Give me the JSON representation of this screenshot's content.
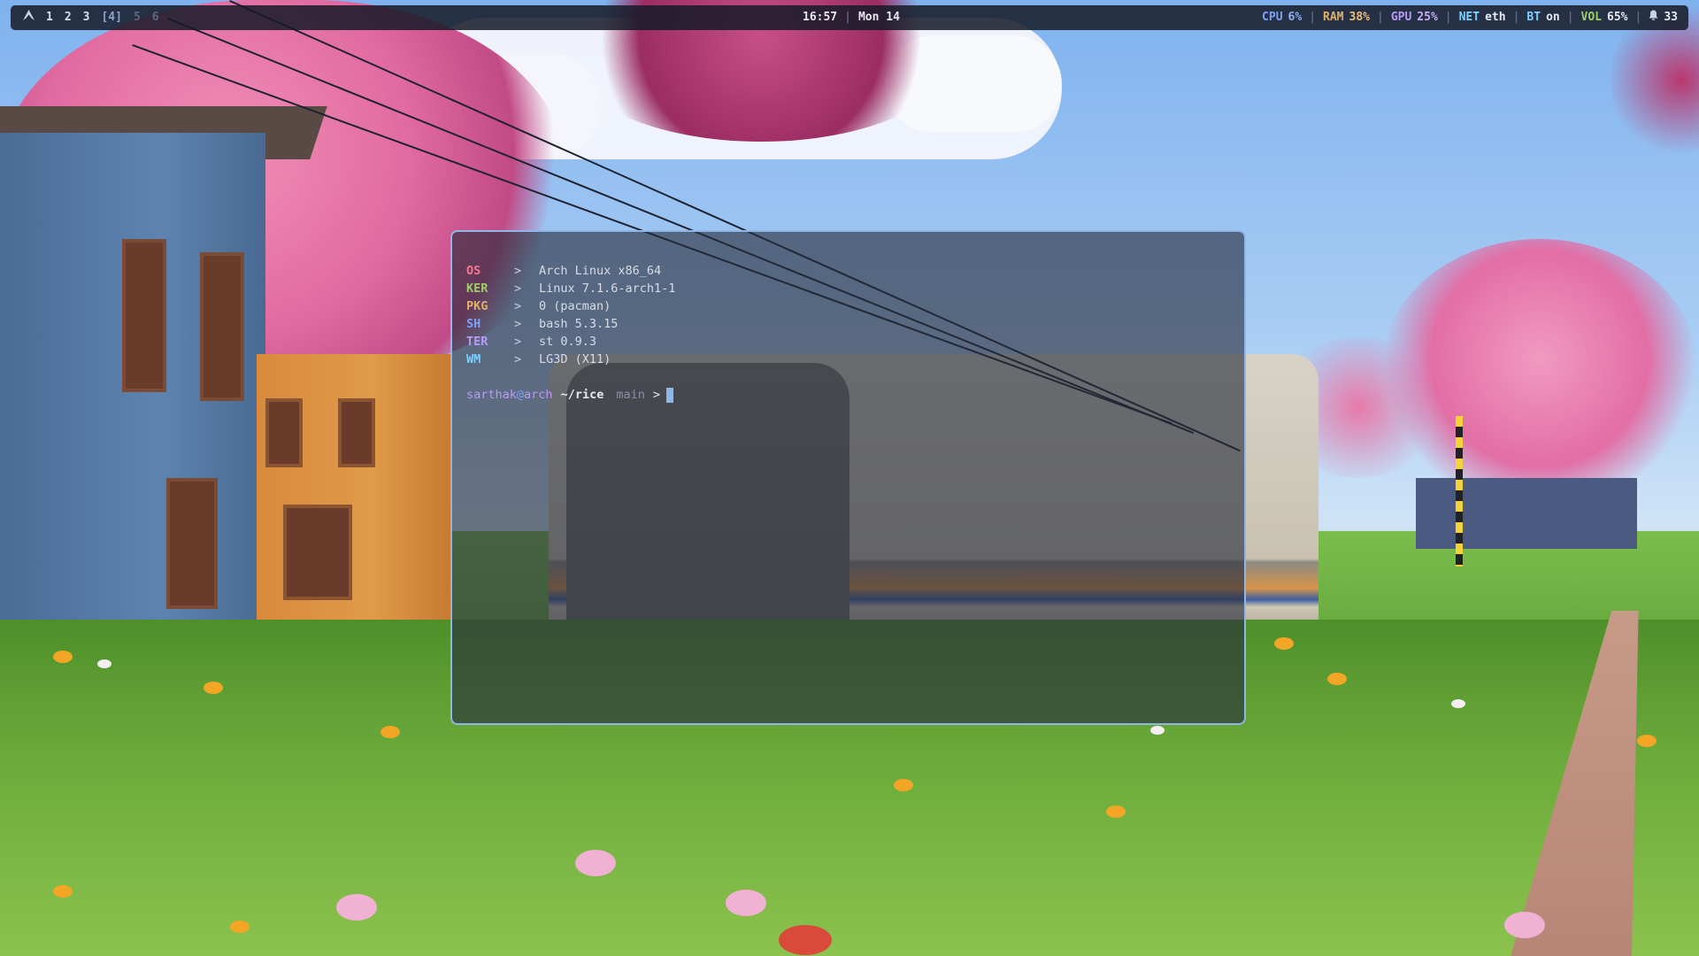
{
  "bar": {
    "workspaces": [
      "1",
      "2",
      "3",
      "[4]",
      "5",
      "6"
    ],
    "time": "16:57",
    "separator": "|",
    "date": "Mon 14",
    "modules": {
      "cpu": {
        "label": "CPU",
        "value": "6%"
      },
      "ram": {
        "label": "RAM",
        "value": "38%"
      },
      "gpu": {
        "label": "GPU",
        "value": "25%"
      },
      "net": {
        "label": "NET",
        "value": "eth"
      },
      "bt": {
        "label": "BT",
        "value": "on"
      },
      "vol": {
        "label": "VOL",
        "value": "65%"
      },
      "notifications": {
        "value": "33"
      }
    },
    "logo_icon": "arch-logo-icon",
    "notification_icon": "bell-icon"
  },
  "terminal": {
    "info": [
      {
        "key": "OS",
        "arrow": ">",
        "value": "Arch Linux x86_64"
      },
      {
        "key": "KER",
        "arrow": ">",
        "value": "Linux 7.1.6-arch1-1"
      },
      {
        "key": "PKG",
        "arrow": ">",
        "value": "0 (pacman)"
      },
      {
        "key": "SH",
        "arrow": ">",
        "value": "bash 5.3.15"
      },
      {
        "key": "TER",
        "arrow": ">",
        "value": "st 0.9.3"
      },
      {
        "key": "WM",
        "arrow": ">",
        "value": "LG3D (X11)"
      }
    ],
    "prompt": {
      "user": "sarthak",
      "at": "@",
      "host": "arch",
      "path": "~/rice",
      "branch": "main",
      "symbol": ">"
    }
  },
  "colors": {
    "bar_background": "#161b28",
    "terminal_border": "#8fb6e6",
    "key_os": "#f7768e",
    "key_ker": "#9ece6a",
    "key_pkg": "#e0af68",
    "key_sh": "#7aa2f7",
    "key_ter": "#bb9af7",
    "key_wm": "#7dcfff"
  }
}
